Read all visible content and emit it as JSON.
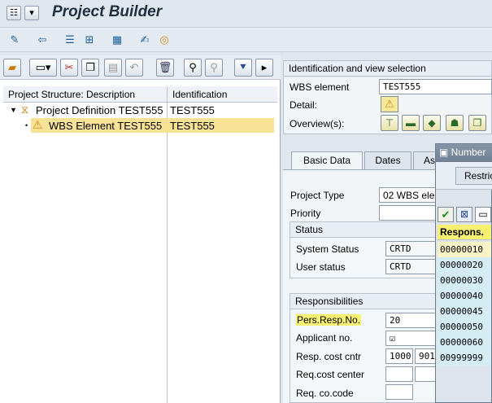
{
  "titlebar": {
    "title": "Project Builder"
  },
  "tree": {
    "col_description": "Project Structure: Description",
    "col_identification": "Identification",
    "rows": [
      {
        "description": "Project Definition TEST555",
        "identification": "TEST555"
      },
      {
        "description": "WBS Element TEST555",
        "identification": "TEST555"
      }
    ]
  },
  "ident_view": {
    "header": "Identification and view selection",
    "wbs_label": "WBS element",
    "wbs_value": "TEST555",
    "detail_label": "Detail:",
    "overview_label": "Overview(s):"
  },
  "tabs": [
    {
      "label": "Basic Data"
    },
    {
      "label": "Dates"
    },
    {
      "label": "As"
    }
  ],
  "basic_data": {
    "project_type_label": "Project Type",
    "project_type_value": "02 WBS ele",
    "priority_label": "Priority",
    "priority_value": ""
  },
  "status": {
    "header": "Status",
    "system_status_label": "System Status",
    "system_status_value": "CRTD",
    "user_status_label": "User status",
    "user_status_value": "CRTD"
  },
  "responsibilities": {
    "header": "Responsibilities",
    "pers_resp_label": "Pers.Resp.No.",
    "pers_resp_value": "20",
    "applicant_label": "Applicant no.",
    "applicant_value": "☑",
    "resp_cost_label": "Resp. cost cntr",
    "resp_cost_value1": "1000",
    "resp_cost_value2": "901",
    "req_cost_label": "Req.cost center",
    "req_co_label": "Req. co.code"
  },
  "popup": {
    "title": "Number",
    "restrict_tab": "Restric",
    "column_header": "Respons.",
    "items": [
      "00000010",
      "00000020",
      "00000030",
      "00000040",
      "00000045",
      "00000050",
      "00000060",
      "00999999"
    ]
  }
}
